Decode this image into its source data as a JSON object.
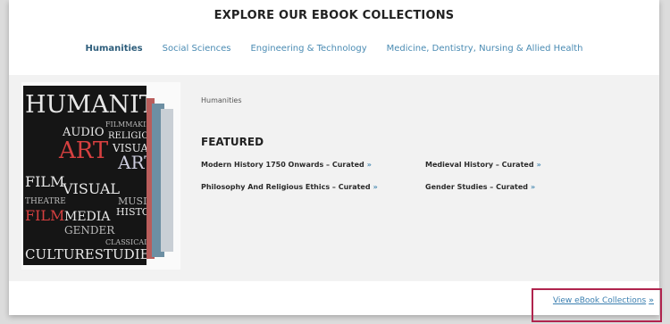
{
  "heading": "EXPLORE OUR EBOOK COLLECTIONS",
  "tabs": [
    {
      "label": "Humanities",
      "active": true
    },
    {
      "label": "Social Sciences",
      "active": false
    },
    {
      "label": "Engineering & Technology",
      "active": false
    },
    {
      "label": "Medicine, Dentistry, Nursing & Allied Health",
      "active": false
    }
  ],
  "breadcrumb": "Humanities",
  "featured": {
    "title": "FEATURED",
    "items": [
      {
        "label": "Modern History 1750 Onwards – Curated"
      },
      {
        "label": "Medieval History – Curated"
      },
      {
        "label": "Philosophy And Religious Ethics – Curated"
      },
      {
        "label": "Gender Studies – Curated"
      }
    ]
  },
  "cover_words": {
    "humanity": "HUMANITY",
    "art": "ART",
    "audio": "AUDIO",
    "visual": "VISUAL",
    "film": "FILM",
    "media": "MEDIA",
    "gender": "GENDER",
    "religion": "RELIGION",
    "history": "HISTORY",
    "culture_studies": "CULTURESTUDIES",
    "music": "MUSIC",
    "classical": "CLASSICAL",
    "theatre": "THEATRE",
    "filmmaking": "FILMMAKING"
  },
  "view_link": {
    "label": "View eBook Collections",
    "chevron": "»"
  },
  "colors": {
    "accent": "#4a8bb3",
    "highlight": "#b0244e"
  }
}
